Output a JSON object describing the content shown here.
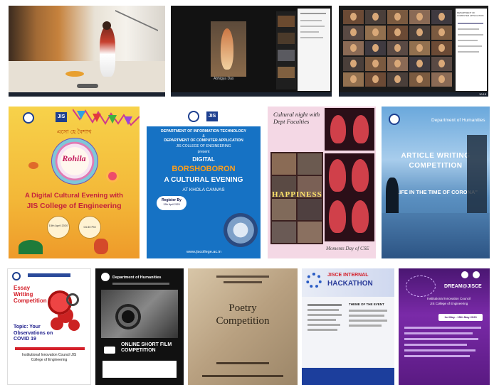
{
  "screenshots": {
    "panel2": {
      "caption": "Abhigya Das"
    },
    "panel3": {
      "side_text": "DEPARTMENT OF COMPUTER APPLICATION",
      "time": "10:15"
    }
  },
  "posters": {
    "rohila": {
      "bengali": "এসো হে বৈশাখ",
      "logo": "JIS",
      "script_title": "Rohila",
      "line1": "A Digital Cultural Evening with",
      "line2": "JIS College of Engineering",
      "date": "15th April 2020",
      "time": "04:30 PM"
    },
    "borshoboron": {
      "logo": "JIS",
      "dept1": "DEPARTMENT OF INFORMATION TECHNOLOGY",
      "amp": "&",
      "dept2": "DEPARTMENT OF COMPUTER APPLICATION",
      "college": "JIS COLLEGE OF ENGINEERING",
      "present": "present",
      "digital": "DIGITAL",
      "title": "BORSHOBORON",
      "subtitle": "A CULTURAL EVENING",
      "venue": "AT KHOLA CANVAS",
      "register": "Register By",
      "register_date": "12th April 2020",
      "url": "www.jiscollege.ac.in"
    },
    "cultural": {
      "title": "Cultural night with Dept Faculties",
      "neon": "HAPPINESS",
      "footer": "Moments Day of CSE"
    },
    "article": {
      "dept": "Department of Humanities",
      "title": "ARTICLE WRITING",
      "title2": "COMPETITION",
      "topic": "\"LIFE IN THE TIME OF CORONA\""
    },
    "essay": {
      "title": "Essay Writing Competition",
      "topic": "Topic: Your Observations on COVID 19",
      "organizer": "Institutional Innovation Council JIS College of Engineering"
    },
    "film": {
      "dept": "Department of Humanities",
      "title": "ONLINE SHORT FILM COMPETITION"
    },
    "poetry": {
      "title1": "Poetry",
      "title2": "Competition"
    },
    "hackathon": {
      "title": "JISCE INTERNAL",
      "title2": "HACKATHON",
      "theme": "THEME OF THE EVENT"
    },
    "dream": {
      "title": "DREAM@JISCE",
      "organizer": "Institutional Innovation Council",
      "college": "JIS College of Engineering",
      "dates": "1st May - 15th May 2020"
    }
  }
}
